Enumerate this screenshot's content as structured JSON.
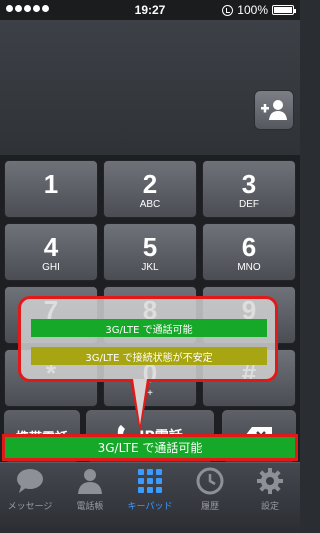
{
  "status_bar": {
    "time": "19:27",
    "battery": "100%"
  },
  "keypad": [
    {
      "digit": "1",
      "letters": ""
    },
    {
      "digit": "2",
      "letters": "ABC"
    },
    {
      "digit": "3",
      "letters": "DEF"
    },
    {
      "digit": "4",
      "letters": "GHI"
    },
    {
      "digit": "5",
      "letters": "JKL"
    },
    {
      "digit": "6",
      "letters": "MNO"
    },
    {
      "digit": "7",
      "letters": ""
    },
    {
      "digit": "8",
      "letters": ""
    },
    {
      "digit": "9",
      "letters": ""
    },
    {
      "digit": "*",
      "letters": ""
    },
    {
      "digit": "0",
      "letters": "+"
    },
    {
      "digit": "#",
      "letters": ""
    }
  ],
  "buttons": {
    "mobile_call": "携帯電話",
    "ip_call": "IP電話"
  },
  "status_strip": {
    "text": "3G/LTE で通話可能",
    "color": "#16a828"
  },
  "popup": {
    "items": [
      {
        "text": "3G/LTE で通話可能",
        "color": "#16a828"
      },
      {
        "text": "3G/LTE で接続状態が不安定",
        "color": "#a8a512"
      }
    ]
  },
  "tabs": [
    {
      "label": "メッセージ",
      "icon": "speech-bubble-icon",
      "active": false
    },
    {
      "label": "電話帳",
      "icon": "contacts-icon",
      "active": false
    },
    {
      "label": "キーパッド",
      "icon": "keypad-icon",
      "active": true
    },
    {
      "label": "履歴",
      "icon": "clock-icon",
      "active": false
    },
    {
      "label": "設定",
      "icon": "gear-icon",
      "active": false
    }
  ],
  "colors": {
    "highlight_border": "#e11919",
    "active_tab": "#3b9bff"
  }
}
